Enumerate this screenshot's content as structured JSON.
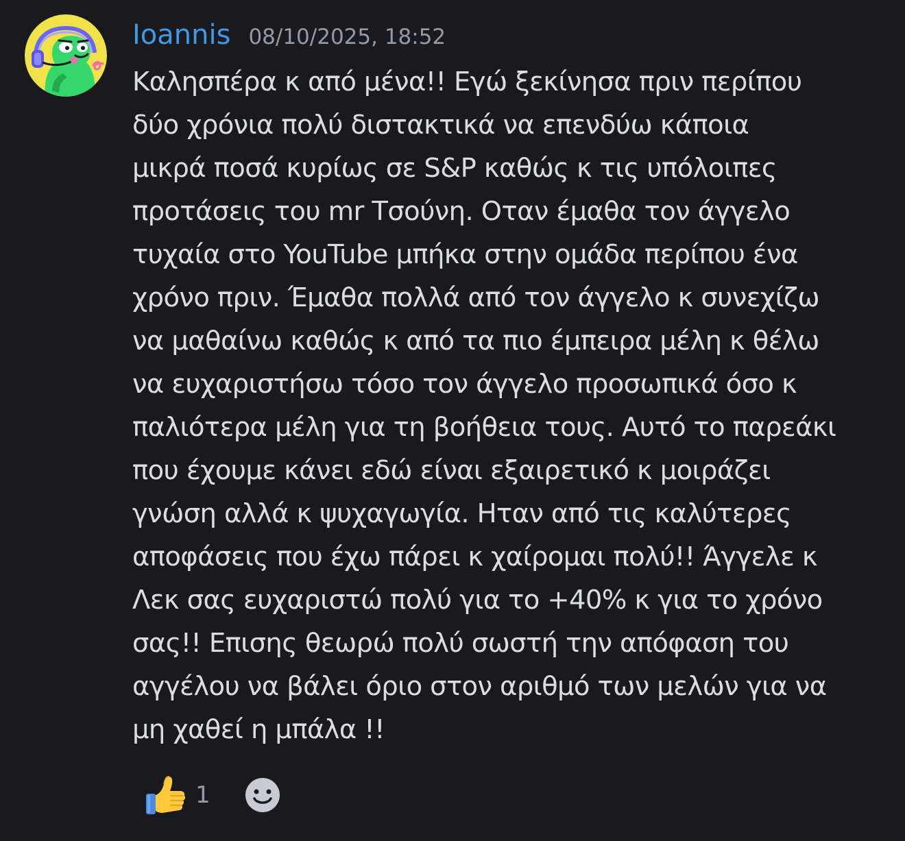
{
  "message": {
    "author": "Ioannis",
    "timestamp": "08/10/2025, 18:52",
    "text": "Καλησπέρα κ από μένα!! Εγώ ξεκίνησα πριν περίπου\nδύο χρόνια πολύ διστακτικά να επενδύω κάποια\nμικρά ποσά κυρίως σε S&P καθώς κ τις υπόλοιπες\nπροτάσεις του mr Τσούνη. Οταν έμαθα τον άγγελο\nτυχαία στο YouTube μπήκα στην ομάδα περίπου ένα\nχρόνο πριν. Έμαθα πολλά από τον άγγελο κ συνεχίζω\nνα μαθαίνω καθώς κ από τα πιο έμπειρα μέλη κ θέλω\nνα ευχαριστήσω τόσο τον άγγελο προσωπικά όσο κ\nπαλιότερα μέλη για τη βοήθεια τους. Αυτό το παρεάκι\nπου έχουμε κάνει εδώ είναι εξαιρετικό κ μοιράζει\nγνώση αλλά κ ψυχαγωγία. Ηταν από τις καλύτερες\nαποφάσεις που έχω πάρει κ χαίρομαι πολύ!! Άγγελε κ\nΛεκ σας ευχαριστώ πολύ για το +40% κ για το χρόνο\nσας!! Επισης θεωρώ πολύ σωστή την απόφαση του\nαγγέλου να βάλει όριο στον αριθμό των μελών για να\nμη χαθεί η μπάλα !!",
    "avatar_icon": "avatar-green-character-headset-icon"
  },
  "reactions": [
    {
      "emoji": "thumbs-up-icon",
      "count": "1"
    }
  ],
  "add_reaction_icon": "smiley-add-reaction-icon",
  "colors": {
    "background": "#1a1a1e",
    "username": "#3e9ae6",
    "timestamp": "#949ba4",
    "text": "#dbdee1",
    "avatar_bg": "#f2e24a",
    "avatar_character": "#35d66a"
  }
}
